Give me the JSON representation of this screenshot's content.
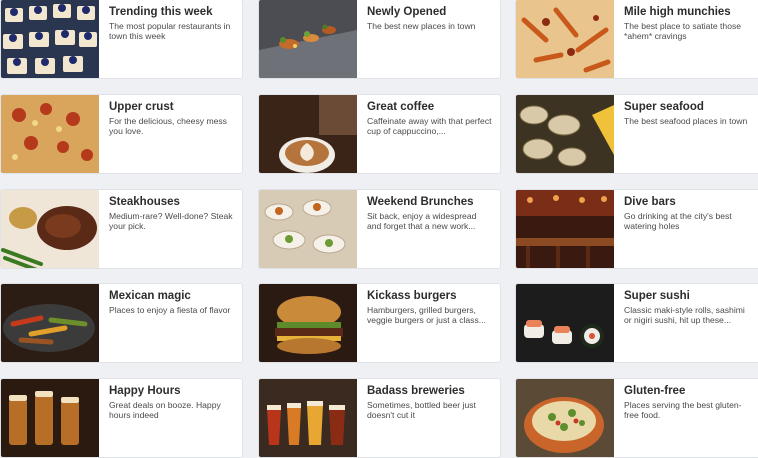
{
  "collections": [
    {
      "title": "Trending this week",
      "description": "The most popular restaurants in town this week",
      "image_icon": "dessert-tarts-photo"
    },
    {
      "title": "Newly Opened",
      "description": "The best new places in town",
      "image_icon": "plated-dish-photo"
    },
    {
      "title": "Mile high munchies",
      "description": "The best place to satiate those *ahem* cravings",
      "image_icon": "loaded-fries-photo"
    },
    {
      "title": "Upper crust",
      "description": "For the delicious, cheesy mess you love.",
      "image_icon": "pizza-photo"
    },
    {
      "title": "Great coffee",
      "description": "Caffeinate away with that perfect cup of cappuccino,...",
      "image_icon": "latte-art-photo"
    },
    {
      "title": "Super seafood",
      "description": "The best seafood places in town",
      "image_icon": "clams-photo"
    },
    {
      "title": "Steakhouses",
      "description": "Medium-rare? Well-done? Steak your pick.",
      "image_icon": "steak-photo"
    },
    {
      "title": "Weekend Brunches",
      "description": "Sit back, enjoy a widespread and forget that a new work...",
      "image_icon": "buffet-photo"
    },
    {
      "title": "Dive bars",
      "description": "Go drinking at the city's best watering holes",
      "image_icon": "bar-interior-photo"
    },
    {
      "title": "Mexican magic",
      "description": "Places to enjoy a fiesta of flavor",
      "image_icon": "fajitas-photo"
    },
    {
      "title": "Kickass burgers",
      "description": "Hamburgers, grilled burgers, veggie burgers or just a class...",
      "image_icon": "burger-photo"
    },
    {
      "title": "Super sushi",
      "description": "Classic maki-style rolls, sashimi or nigiri sushi, hit up these...",
      "image_icon": "sushi-photo"
    },
    {
      "title": "Happy Hours",
      "description": "Great deals on booze. Happy hours indeed",
      "image_icon": "beer-glasses-photo"
    },
    {
      "title": "Badass breweries",
      "description": "Sometimes, bottled beer just doesn't cut it",
      "image_icon": "beer-flight-photo"
    },
    {
      "title": "Gluten-free",
      "description": "Places serving the best gluten-free food.",
      "image_icon": "quinoa-bowl-photo"
    }
  ]
}
